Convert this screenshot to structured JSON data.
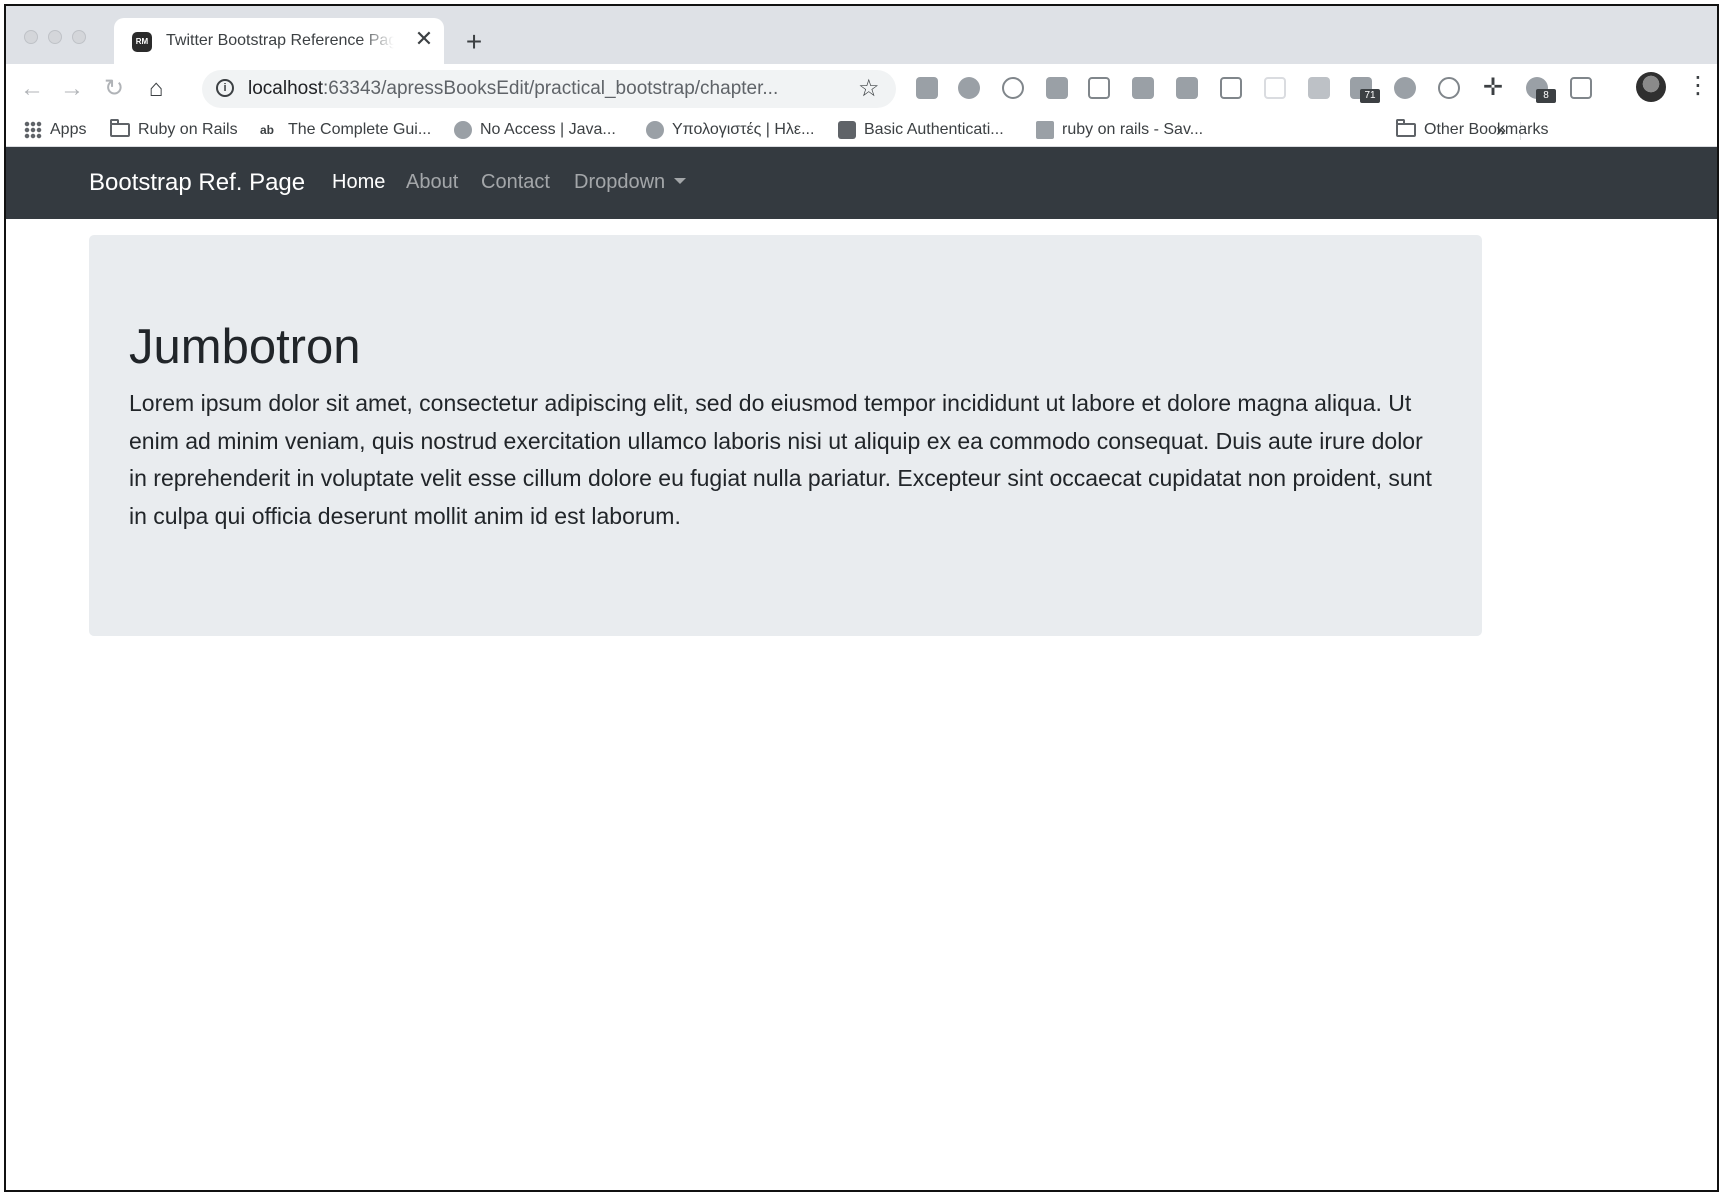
{
  "browser": {
    "tab_title": "Twitter Bootstrap Reference Page",
    "tab_favicon_text": "RM",
    "close_glyph": "✕",
    "new_tab_glyph": "+",
    "url_host": "localhost",
    "url_rest": ":63343/apressBooksEdit/practical_bootstrap/chapter...",
    "extension_badges": [
      "71",
      "8"
    ],
    "bookmarks": [
      {
        "label": "Apps",
        "icon": "apps-grid-icon"
      },
      {
        "label": "Ruby on Rails",
        "icon": "folder-icon"
      },
      {
        "label": "The Complete Gui...",
        "icon": "ab-favicon"
      },
      {
        "label": "No Access | Java...",
        "icon": "bug-favicon"
      },
      {
        "label": "Υπολογιστές | Ηλε...",
        "icon": "parachute-favicon"
      },
      {
        "label": "Basic Authenticati...",
        "icon": "cube-favicon"
      },
      {
        "label": "ruby on rails - Sav...",
        "icon": "stackoverflow-favicon"
      }
    ],
    "overflow_glyph": "»",
    "other_bookmarks": "Other Bookmarks"
  },
  "page": {
    "brand": "Bootstrap Ref. Page",
    "nav": [
      {
        "label": "Home",
        "active": true
      },
      {
        "label": "About"
      },
      {
        "label": "Contact"
      },
      {
        "label": "Dropdown"
      }
    ],
    "jumbotron": {
      "heading": "Jumbotron",
      "text": "Lorem ipsum dolor sit amet, consectetur adipiscing elit, sed do eiusmod tempor incididunt ut labore et dolore magna aliqua. Ut enim ad minim veniam, quis nostrud exercitation ullamco laboris nisi ut aliquip ex ea commodo consequat. Duis aute irure dolor in reprehenderit in voluptate velit esse cillum dolore eu fugiat nulla pariatur. Excepteur sint occaecat cupidatat non proident, sunt in culpa qui officia deserunt mollit anim id est laborum."
    }
  },
  "colors": {
    "navbar": "#343a40",
    "jumbotron": "#e9ecef",
    "tabstrip": "#dee1e6"
  }
}
